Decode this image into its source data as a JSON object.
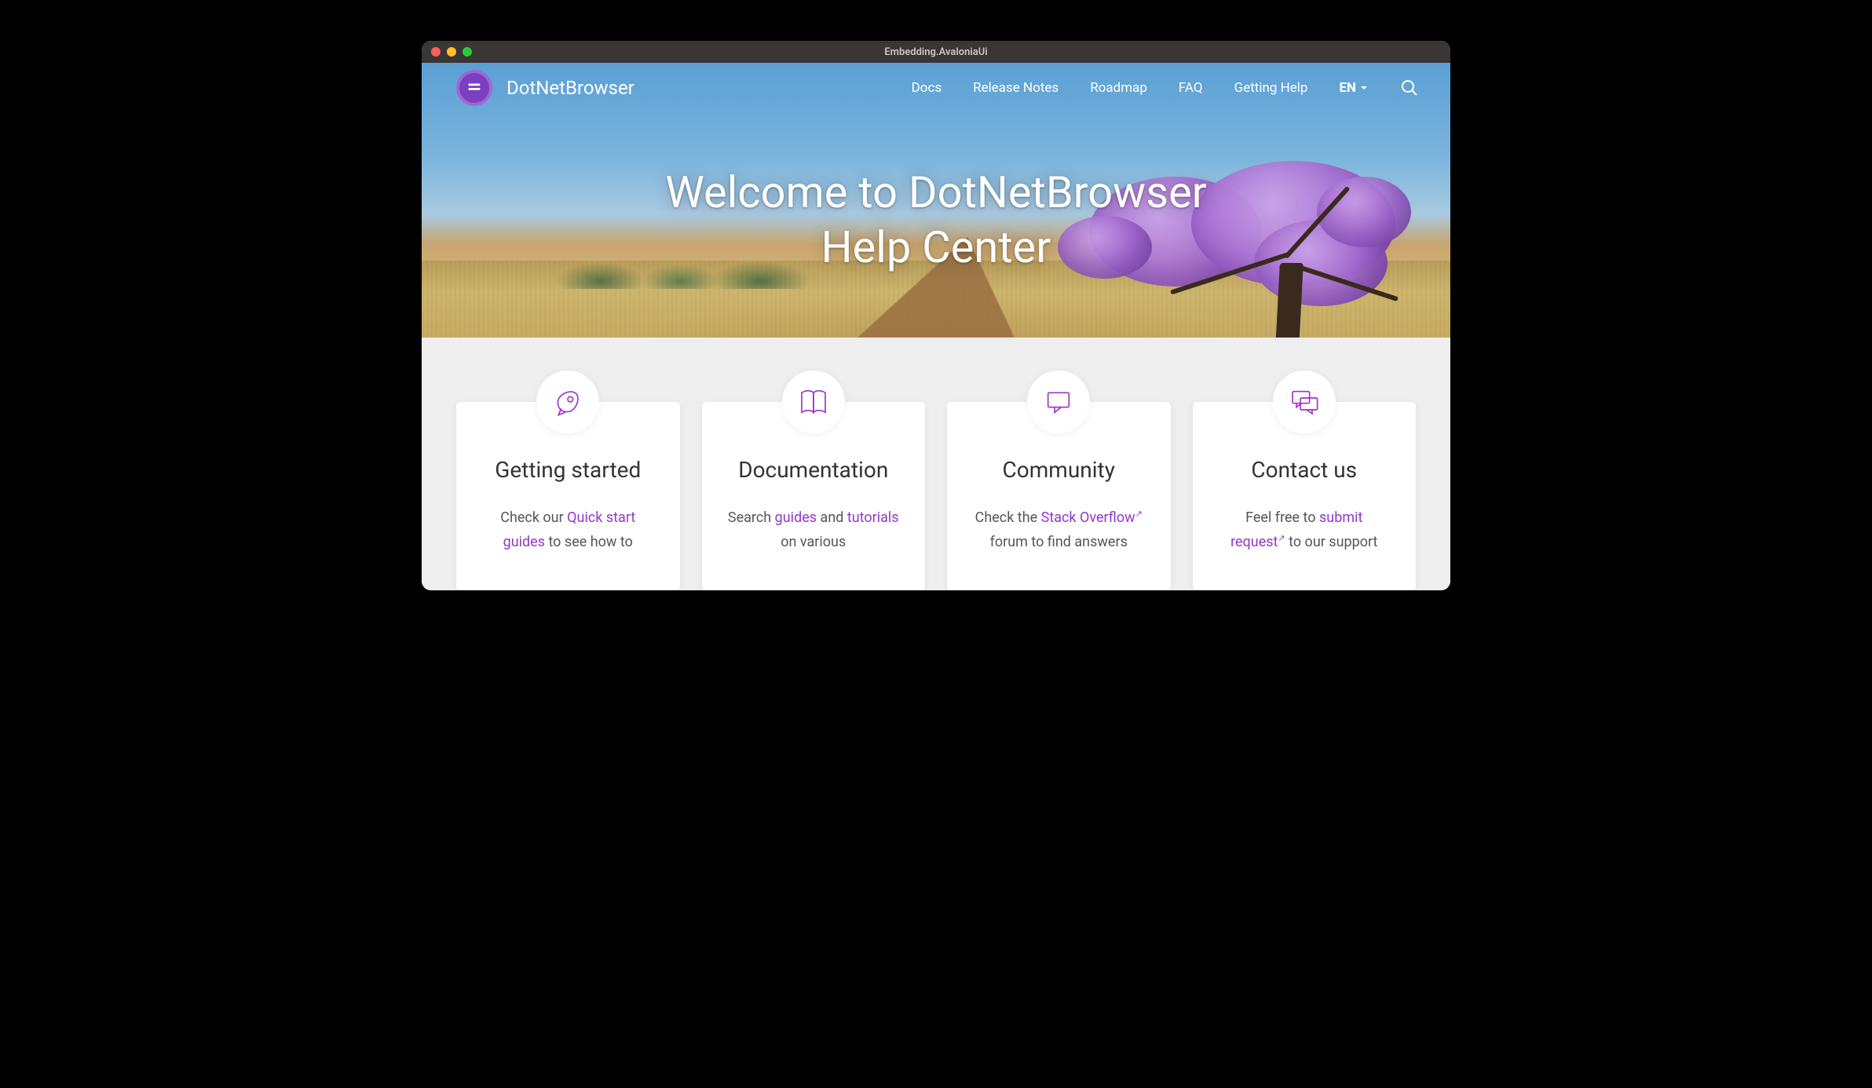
{
  "window": {
    "title": "Embedding.AvaloniaUi"
  },
  "brand": {
    "name": "DotNetBrowser"
  },
  "nav": {
    "items": [
      "Docs",
      "Release Notes",
      "Roadmap",
      "FAQ",
      "Getting Help"
    ],
    "language": "EN"
  },
  "hero": {
    "title_line1": "Welcome to DotNetBrowser",
    "title_line2": "Help Center"
  },
  "cards": [
    {
      "title": "Getting started",
      "before1": "Check our ",
      "link1": "Quick start guides",
      "after1": " to see how to"
    },
    {
      "title": "Documentation",
      "before1": "Search ",
      "link1": "guides",
      "mid": " and ",
      "link2": "tutorials",
      "after2": " on various"
    },
    {
      "title": "Community",
      "before1": "Check the ",
      "link1": "Stack Overflow",
      "after1": " forum to find answers",
      "external1": true
    },
    {
      "title": "Contact us",
      "before1": "Feel free to ",
      "link1": "submit request",
      "after1": " to our support",
      "external1": true
    }
  ],
  "colors": {
    "accent": "#a033c8"
  }
}
